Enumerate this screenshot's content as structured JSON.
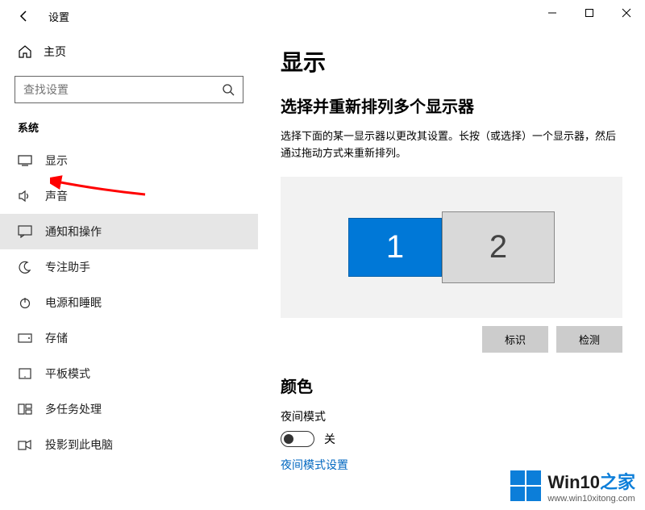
{
  "window": {
    "title": "设置"
  },
  "sidebar": {
    "home": "主页",
    "search_placeholder": "查找设置",
    "category": "系统",
    "items": [
      {
        "label": "显示"
      },
      {
        "label": "声音"
      },
      {
        "label": "通知和操作"
      },
      {
        "label": "专注助手"
      },
      {
        "label": "电源和睡眠"
      },
      {
        "label": "存储"
      },
      {
        "label": "平板模式"
      },
      {
        "label": "多任务处理"
      },
      {
        "label": "投影到此电脑"
      }
    ]
  },
  "main": {
    "title": "显示",
    "rearrange_heading": "选择并重新排列多个显示器",
    "rearrange_desc": "选择下面的某一显示器以更改其设置。长按（或选择）一个显示器，然后通过拖动方式来重新排列。",
    "monitors": {
      "m1": "1",
      "m2": "2"
    },
    "identify": "标识",
    "detect": "检测",
    "color_heading": "颜色",
    "night_label": "夜间模式",
    "toggle_state": "关",
    "night_link": "夜间模式设置"
  },
  "watermark": {
    "brand_prefix": "Win10",
    "brand_suffix": "之家",
    "url": "www.win10xitong.com"
  }
}
